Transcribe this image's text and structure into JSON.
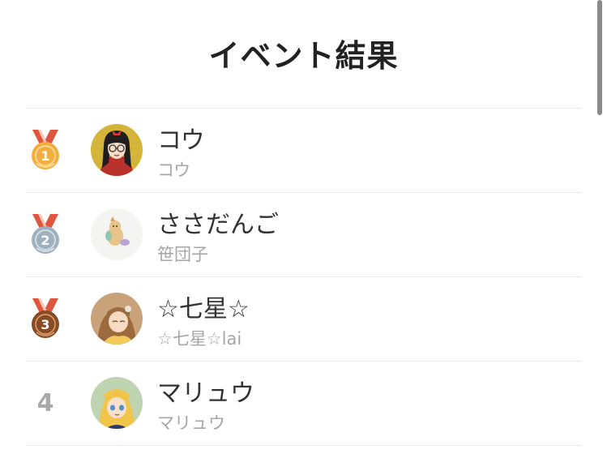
{
  "header": {
    "title": "イベント結果"
  },
  "ranking": [
    {
      "rank": "1",
      "medal": "gold",
      "medal_color": "#F2AE3F",
      "ribbon_color": "#E0553F",
      "name": "コウ",
      "sub": "コウ",
      "avatar_bg": "#D4B53A"
    },
    {
      "rank": "2",
      "medal": "silver",
      "medal_color": "#9FB0BF",
      "ribbon_color": "#E0553F",
      "name": "ささだんご",
      "sub": "笹団子",
      "avatar_bg": "#F4F4F2"
    },
    {
      "rank": "3",
      "medal": "bronze",
      "medal_color": "#8A4B22",
      "ribbon_color": "#E0553F",
      "name": "☆七星☆",
      "sub": "☆七星☆lai",
      "avatar_bg": "#C9A27A"
    },
    {
      "rank": "4",
      "medal": "none",
      "name": "マリュウ",
      "sub": "マリュウ",
      "avatar_bg": "#BFD4B0"
    }
  ]
}
